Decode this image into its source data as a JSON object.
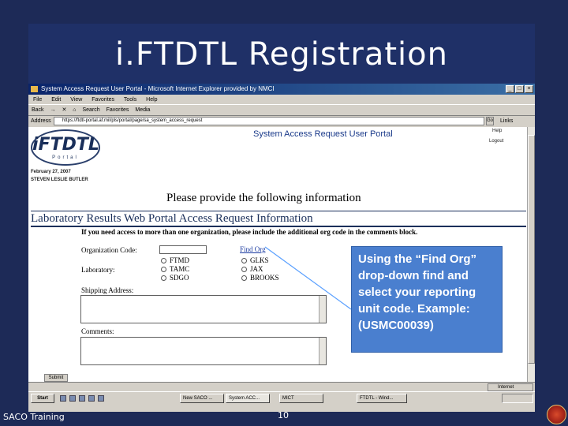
{
  "slide": {
    "title": "i.FTDTL Registration",
    "footer_left": "SACO Training",
    "page_number": "10",
    "callout": "Using the “Find Org” drop-down find and select your reporting unit code. Example: (USMC00039)"
  },
  "browser": {
    "window_title": "System Access Request User Portal - Microsoft Internet Explorer provided by NMCI",
    "window_buttons": [
      "_",
      "□",
      "×"
    ],
    "menu": [
      "File",
      "Edit",
      "View",
      "Favorites",
      "Tools",
      "Help"
    ],
    "toolbar": [
      "Back",
      "→",
      "✕",
      "⌂",
      "Search",
      "Favorites",
      "Media"
    ],
    "address_label": "Address",
    "address_value": "https://ftdtl-portal.af.mil/pls/portal/page/sa_system_access_request",
    "go_label": "Go",
    "links_label": "Links",
    "status_zone": "Internet",
    "accent": "#0a246a"
  },
  "portal": {
    "logo_text": "iFTDTL",
    "logo_sub": "Portal",
    "heading": "System Access Request User Portal",
    "top_links": [
      "Help",
      "Logout"
    ],
    "date": "February 27, 2007",
    "user": "STEVEN LESLIE BUTLER",
    "provide_info": "Please provide the following information",
    "section_header": "Laboratory Results Web Portal Access Request Information",
    "instructions": "If you need access to more than one organization, please include the additional org code in the comments block.",
    "org_code_label": "Organization Code:",
    "find_org_link": "Find Org",
    "laboratory_label": "Laboratory:",
    "labs": [
      "FTMD",
      "GLKS",
      "TAMC",
      "JAX",
      "SDGO",
      "BROOKS"
    ],
    "shipping_label": "Shipping Address:",
    "comments_label": "Comments:",
    "submit_label": "Submit"
  },
  "taskbar": {
    "start_label": "Start",
    "tasks": [
      "New SACO ...",
      "System ACC...",
      "MICT",
      "FTDTL - Wind..."
    ]
  }
}
